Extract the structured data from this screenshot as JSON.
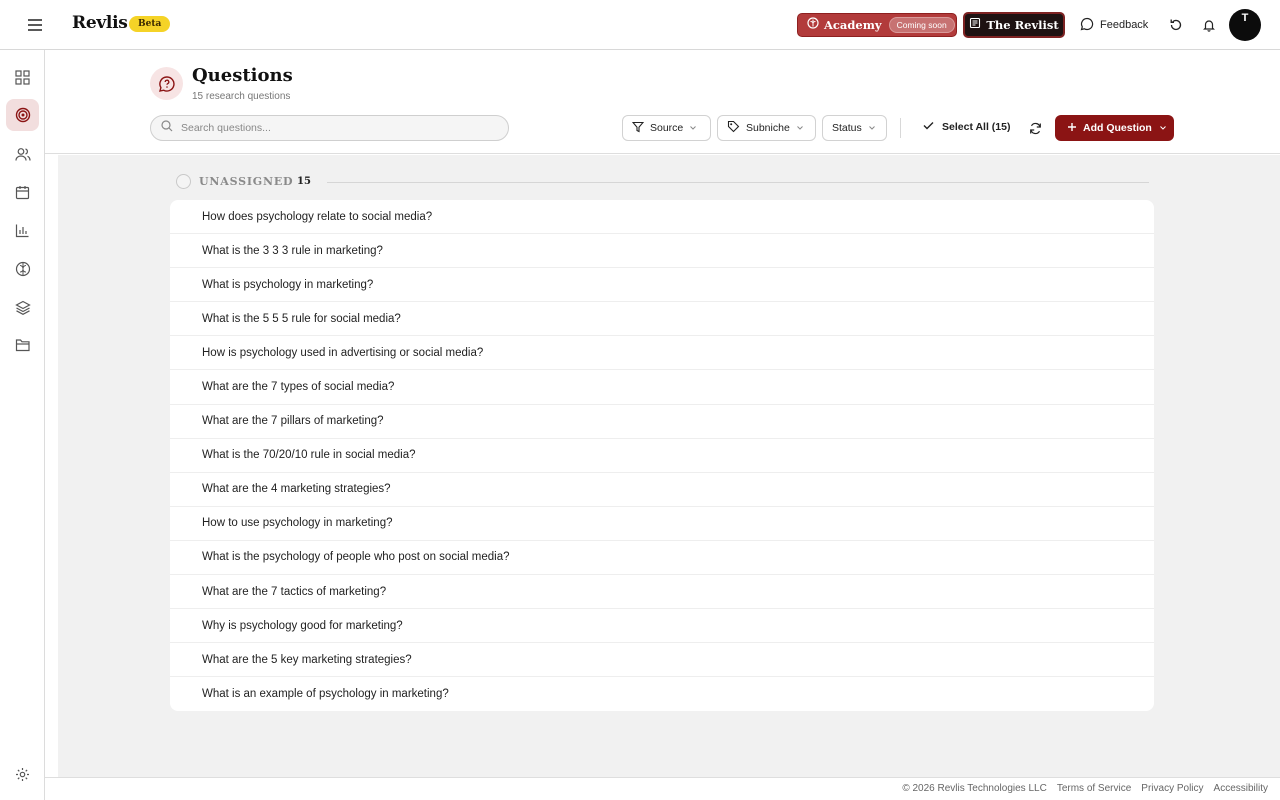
{
  "header": {
    "logo": "Revlis",
    "beta_badge": "Beta",
    "academy_label": "Academy",
    "academy_badge": "Coming soon",
    "revlist_label": "The Revlist",
    "feedback_label": "Feedback",
    "avatar_initial": "T"
  },
  "page": {
    "title": "Questions",
    "subtitle": "15 research questions"
  },
  "toolbar": {
    "search_placeholder": "Search questions...",
    "filters": {
      "source": "Source",
      "subniche": "Subniche",
      "status": "Status"
    },
    "select_all": "Select All (15)",
    "add_question": "Add Question"
  },
  "group": {
    "label": "UNASSIGNED",
    "count": "15"
  },
  "questions": [
    "How does psychology relate to social media?",
    "What is the 3 3 3 rule in marketing?",
    "What is psychology in marketing?",
    "What is the 5 5 5 rule for social media?",
    "How is psychology used in advertising or social media?",
    "What are the 7 types of social media?",
    "What are the 7 pillars of marketing?",
    "What is the 70/20/10 rule in social media?",
    "What are the 4 marketing strategies?",
    "How to use psychology in marketing?",
    "What is the psychology of people who post on social media?",
    "What are the 7 tactics of marketing?",
    "Why is psychology good for marketing?",
    "What are the 5 key marketing strategies?",
    "What is an example of psychology in marketing?"
  ],
  "footer": {
    "copyright": "© 2026 Revlis Technologies LLC",
    "terms": "Terms of Service",
    "privacy": "Privacy Policy",
    "accessibility": "Accessibility"
  },
  "sidebar": {
    "items": [
      "grid-icon",
      "target-icon",
      "users-icon",
      "calendar-icon",
      "bar-chart-icon",
      "brain-icon",
      "layers-icon",
      "folder-icon",
      "settings-icon"
    ]
  },
  "colors": {
    "brand_red": "#8b1414",
    "academy_red": "#b23b3b",
    "beta_yellow": "#f5d327",
    "active_bg": "#f2dede"
  }
}
